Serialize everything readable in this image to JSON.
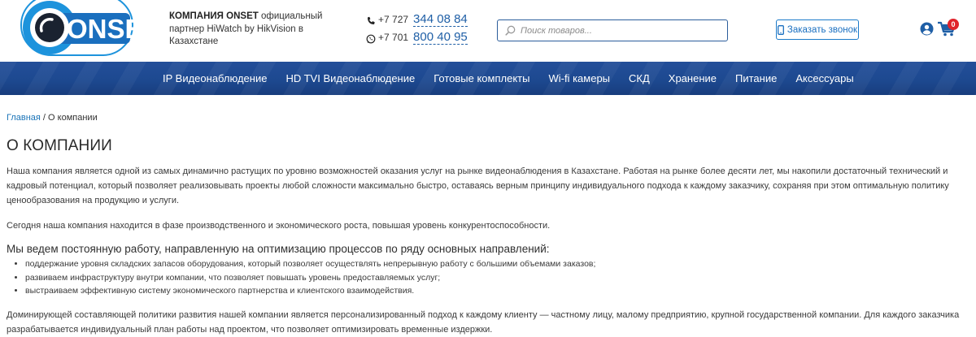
{
  "brand": {
    "logo_text": "ONSET",
    "company_name": "КОМПАНИЯ ONSET",
    "company_desc": " официальный партнер HiWatch by HikVision в Казахстане"
  },
  "contacts": {
    "phone1_code": "+7 727",
    "phone1_number": "344 08 84",
    "phone2_code": "+7 701",
    "phone2_number": "800 40 95"
  },
  "search": {
    "placeholder": "Поиск товаров..."
  },
  "callback_label": "Заказать звонок",
  "cart": {
    "count": "0"
  },
  "nav": {
    "items": [
      {
        "label": "IP Видеонаблюдение"
      },
      {
        "label": "HD TVI Видеонаблюдение"
      },
      {
        "label": "Готовые комплекты"
      },
      {
        "label": "Wi-fi камеры"
      },
      {
        "label": "СКД"
      },
      {
        "label": "Хранение"
      },
      {
        "label": "Питание"
      },
      {
        "label": "Аксессуары"
      }
    ]
  },
  "breadcrumb": {
    "home": "Главная",
    "separator": " / ",
    "current": "О компании"
  },
  "page": {
    "title": "О КОМПАНИИ",
    "paragraph1": "Наша компания является одной из самых динамично растущих по уровню возможностей оказания услуг на рынке видеонаблюдения в Казахстане. Работая на рынке более десяти лет, мы накопили достаточный технический и кадровый потенциал, который позволяет реализовывать проекты любой сложности максимально быстро, оставаясь верным принципу индивидуального подхода к каждому заказчику, сохраняя при этом оптимальную политику ценообразования на продукцию и услуги.",
    "paragraph2": "Сегодня наша компания находится в фазе производственного и экономического роста, повышая уровень конкурентоспособности.",
    "subheading": "Мы ведем постоянную работу, направленную на оптимизацию процессов по ряду основных направлений:",
    "bullets": [
      "поддержание уровня складских запасов оборудования, который позволяет осуществлять непрерывную работу с большими объемами заказов;",
      "развиваем инфраструктуру внутри компании, что позволяет повышать уровень предоставляемых услуг;",
      "выстраиваем эффективную систему экономического партнерства и клиентского взаимодействия."
    ],
    "paragraph3": "Доминирующей составляющей политики развития нашей компании является персонализированный подход к каждому клиенту — частному лицу, малому предприятию, крупной государственной компании. Для каждого заказчика разрабатывается индивидуальный план работы над проектом, что позволяет оптимизировать временные издержки."
  },
  "colors": {
    "brand_blue": "#1d4990",
    "link_blue": "#1a74b8",
    "badge_red": "#e0232b"
  },
  "icons": [
    "logo-eye-icon",
    "phone-icon",
    "whatsapp-icon",
    "search-icon",
    "mobile-phone-icon",
    "user-icon",
    "cart-icon"
  ]
}
